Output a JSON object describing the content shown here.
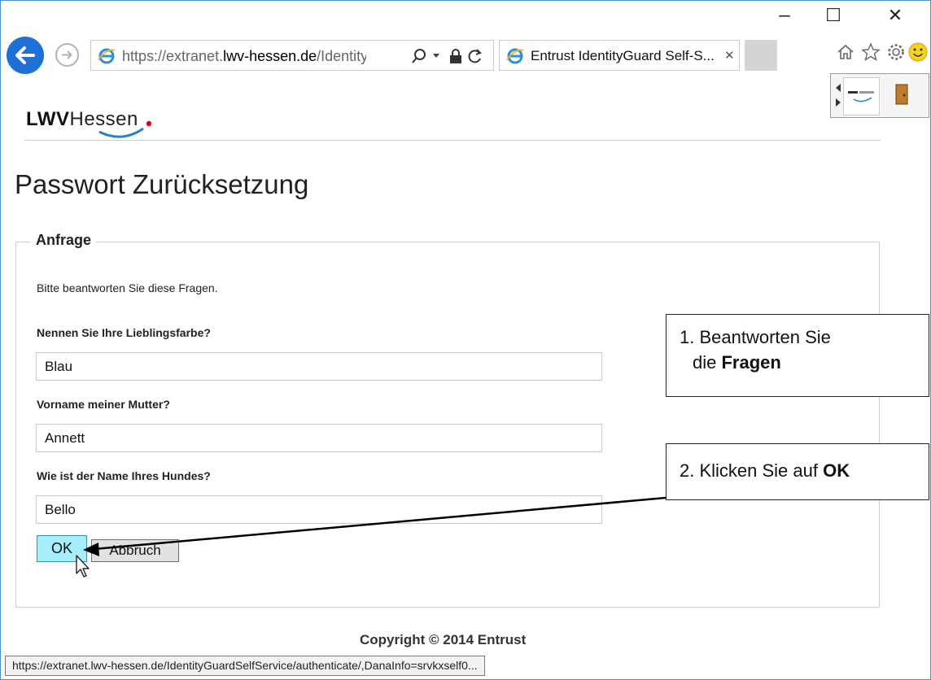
{
  "window": {
    "controls": {
      "minimize": "–",
      "maximize": "☐",
      "close": "✕"
    }
  },
  "browser": {
    "address": {
      "prefix": "https://extranet.",
      "domain": "lwv-hessen.de",
      "path": "/IdentityGuar"
    },
    "tab_title": "Entrust IdentityGuard Self-S...",
    "tab_close": "✕",
    "icons": [
      "back-arrow-icon",
      "forward-arrow-icon",
      "ie-logo-icon",
      "search-icon",
      "dropdown-icon",
      "lock-icon",
      "refresh-icon",
      "home-icon",
      "favorites-star-icon",
      "settings-gear-icon",
      "smiley-feedback-icon",
      "exit-door-icon"
    ]
  },
  "page": {
    "logo": {
      "bold": "LWV",
      "regular": "Hessen"
    },
    "title": "Passwort Zurücksetzung",
    "fieldset_legend": "Anfrage",
    "instruction": "Bitte beantworten Sie diese Fragen.",
    "questions": [
      {
        "label": "Nennen Sie Ihre Lieblingsfarbe?",
        "value": "Blau"
      },
      {
        "label": "Vorname meiner Mutter?",
        "value": "Annett"
      },
      {
        "label": "Wie ist der Name Ihres Hundes?",
        "value": "Bello"
      }
    ],
    "buttons": {
      "ok": "OK",
      "cancel": "Abbruch"
    },
    "copyright": "Copyright © 2014 Entrust"
  },
  "statusbar": {
    "url": "https://extranet.lwv-hessen.de/IdentityGuardSelfService/authenticate/,DanaInfo=srvkxself0..."
  },
  "annotations": {
    "step1": {
      "line1": "1. Beantworten Sie",
      "line2_prefix": "die ",
      "line2_bold": "Fragen"
    },
    "step2": {
      "prefix": "2. Klicken Sie auf ",
      "bold": "OK"
    }
  },
  "colors": {
    "accent_blue": "#1e70d6",
    "ok_button": "#a6eefc",
    "logo_dot": "#d0021b",
    "logo_swoosh": "#2a7fc9"
  }
}
